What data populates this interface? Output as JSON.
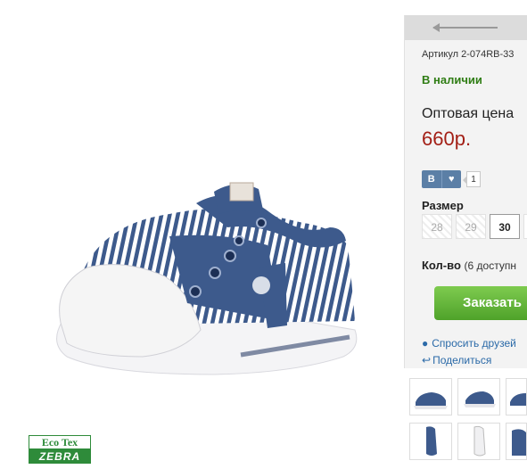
{
  "brand_logo": {
    "top": "Eco Tex",
    "bottom": "ZEBRA"
  },
  "product": {
    "sku": "Артикул 2-074RB-33",
    "stock": "В наличии",
    "price_label": "Оптовая цена",
    "price": "660р."
  },
  "social": {
    "vk_label": "B",
    "like_icon": "heart-icon",
    "like_count": "1"
  },
  "sizes": {
    "label": "Размер",
    "items": [
      {
        "value": "28",
        "state": "disabled"
      },
      {
        "value": "29",
        "state": "disabled"
      },
      {
        "value": "30",
        "state": "active"
      },
      {
        "value": "",
        "state": "partial"
      }
    ]
  },
  "quantity": {
    "label": "Кол-во",
    "note": "(6 доступн"
  },
  "order_button": {
    "label": "Заказать"
  },
  "links": {
    "ask_friends": "Спросить друзей",
    "share": "Поделиться"
  },
  "colors": {
    "price": "#a31f16",
    "stock": "#2f7d14",
    "button": "#5aab33",
    "link": "#2b6aa8",
    "shoe_blue": "#3d5a8c"
  }
}
